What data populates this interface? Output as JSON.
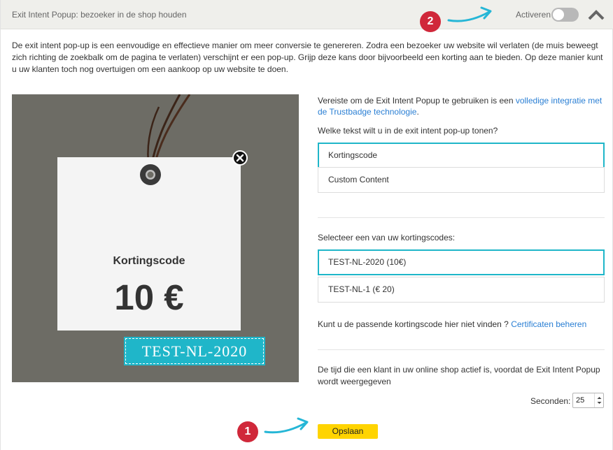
{
  "header": {
    "title": "Exit Intent Popup: bezoeker in de shop houden",
    "activate_label": "Activeren",
    "toggle_on": false
  },
  "annotations": {
    "badge_1": "1",
    "badge_2": "2"
  },
  "intro": "De exit intent pop-up is een eenvoudige en effectieve manier om meer conversie te genereren. Zodra een bezoeker uw website wil verlaten (de muis beweegt zich richting de zoekbalk om de pagina te verlaten) verschijnt er een pop-up. Grijp deze kans door bijvoorbeeld een korting aan te bieden. Op deze manier kunt u uw klanten toch nog overtuigen om een aankoop op uw website te doen.",
  "preview": {
    "title": "Kortingscode",
    "amount": "10 €",
    "code": "TEST-NL-2020"
  },
  "requirement": {
    "text": "Vereiste om de Exit Intent Popup te gebruiken is een ",
    "link": "volledige integratie met de Trustbadge technologie",
    "suffix": "."
  },
  "content_question": "Welke tekst wilt u in de exit intent pop-up tonen?",
  "content_options": [
    {
      "label": "Kortingscode",
      "selected": true
    },
    {
      "label": "Custom Content",
      "selected": false
    }
  ],
  "code_question": "Selecteer een van uw kortingscodes:",
  "code_options": [
    {
      "label": "TEST-NL-2020 (10€)",
      "selected": true
    },
    {
      "label": "TEST-NL-1 (€ 20)",
      "selected": false
    }
  ],
  "help": {
    "text": "Kunt u de passende kortingscode hier niet vinden ? ",
    "link": "Certificaten beheren"
  },
  "time_text": "De tijd die een klant in uw online shop actief is, voordat de Exit Intent Popup wordt weergegeven",
  "seconds": {
    "label": "Seconden:",
    "value": "25"
  },
  "save_label": "Opslaan",
  "colors": {
    "accent": "#1fb6c9",
    "save": "#ffd400",
    "badge": "#d0283a",
    "link": "#2a7fd4"
  }
}
